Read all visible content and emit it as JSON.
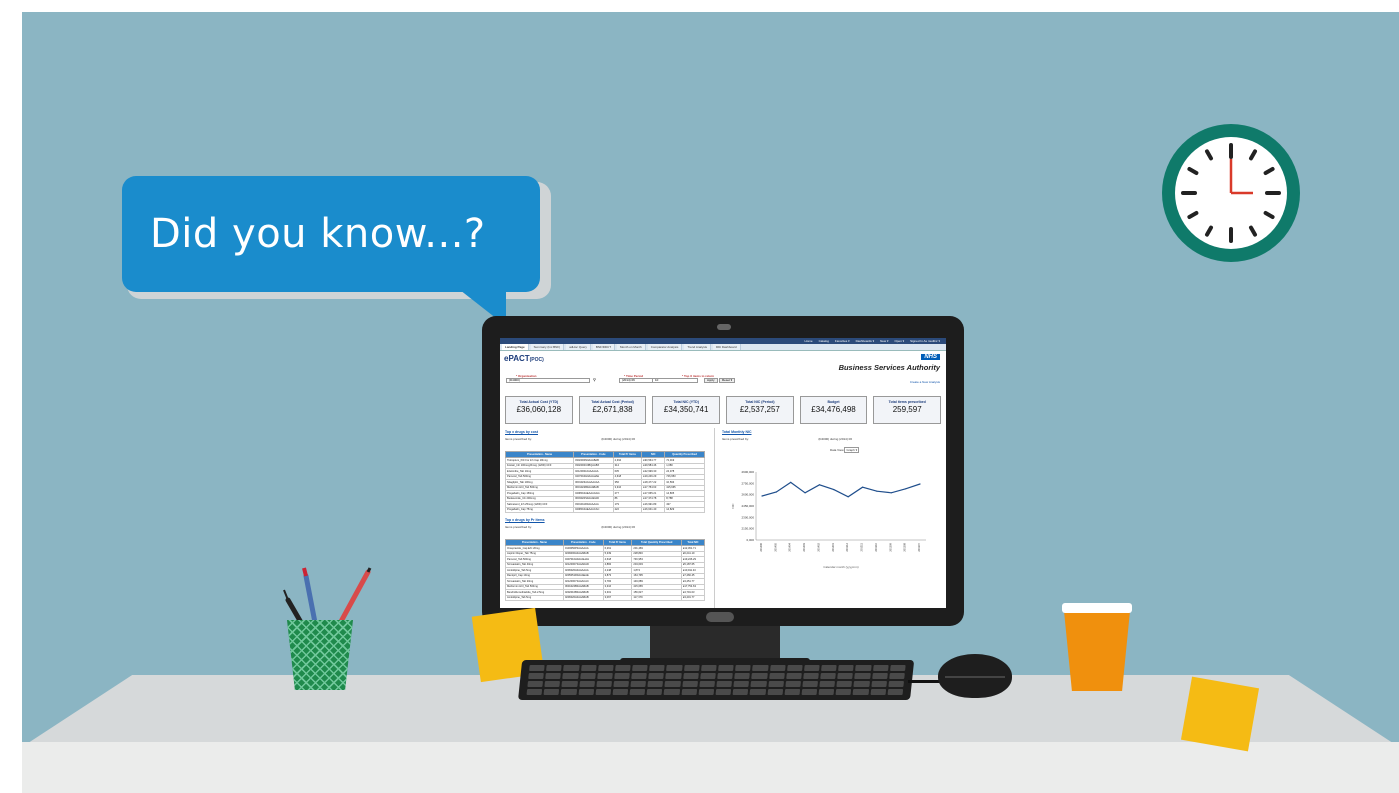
{
  "bubble": {
    "text": "Did you know...?"
  },
  "clock": {
    "time": "3:00"
  },
  "colors": {
    "wall": "#8bb5c3",
    "bubble": "#1a8ccc",
    "clock_ring": "#0f7a6a",
    "clock_hand": "#d93a2a",
    "cup": "#f0900d",
    "sticky": "#f5bb14",
    "pot": "#1f8a4c",
    "nhs_blue": "#005eb8"
  },
  "screen": {
    "topbar": [
      "Home",
      "Catalog",
      "Favorites ▾",
      "Dashboards ▾",
      "New ▾",
      "Open ▾",
      "Signed In As mudlinr ▾"
    ],
    "tabs": [
      "Landing Page",
      "Summary (Inc BNF)",
      "adHoc Query",
      "BNF/DDCT",
      "Month on Month",
      "Comparator Analysis",
      "Trend Analysis",
      "DDi Dashboard"
    ],
    "app_title": "ePACT",
    "app_title_suffix": "(POC)",
    "nhs_logo": "NHS",
    "bsa_name": "Business Services Authority",
    "create_link": "Create a New Analysis",
    "filters": {
      "org_label": "* Organisation",
      "org_value": "(D4000)",
      "period_label": "* Time Period",
      "period_value": "(2014) 06",
      "topx_label": "* Top X items to return",
      "topx_value": "10",
      "apply": "Apply",
      "reset": "Reset ▾"
    },
    "tiles": [
      {
        "title": "Total Actual Cost (YTD)",
        "value": "£36,060,128"
      },
      {
        "title": "Total Actual Cost (Period)",
        "value": "£2,671,838"
      },
      {
        "title": "Total NIC (YTD)",
        "value": "£34,350,741"
      },
      {
        "title": "Total NIC (Period)",
        "value": "£2,537,257"
      },
      {
        "title": "Budget",
        "value": "£34,476,498"
      },
      {
        "title": "Total items prescribed",
        "value": "259,597"
      }
    ],
    "left": {
      "section1": "Top x drugs by cost",
      "sub1_label": "Items prescribed by:",
      "sub1_value": "(D4000) during (2014) 06",
      "table1_headers": [
        "Presentation - Name",
        "Presentation - Code",
        "Total Pr Items",
        "NIC",
        "Quantity Prescribed"
      ],
      "table1_rows": [
        [
          "Tiotropium_Pdr For Inh Cap 18mcg",
          "0302000N0AAABAB",
          "2,394",
          "£90,564.77",
          "72,019"
        ],
        [
          "Fostair_Inh 100mcg/6mcg (120D) CFF",
          "0302000C0BQAABX",
          "314",
          "£29,584.46",
          "1,080"
        ],
        [
          "Ezetimibe_Tab 10mg",
          "0212000L0AAAAAA",
          "635",
          "£22,999.30",
          "24,378"
        ],
        [
          "Pamorel_Tab 500mg",
          "0407010H0AAAHAH",
          "4,618",
          "£19,246.29",
          "746,953"
        ],
        [
          "Sitagliptin_Tab 100mg",
          "0601023AGAAAAAA",
          "356",
          "£18,477.22",
          "10,593"
        ],
        [
          "Metformin HCl_Tab 500mg",
          "0601022B0AAABAB",
          "3,316",
          "£17,754.63",
          "415,665"
        ],
        [
          "Pregabalin_Cap 150mg",
          "0408010AEAAAGAG",
          "277",
          "£17,665.21",
          "14,805"
        ],
        [
          "Budesonide_Inh 200mcg",
          "0603020S0AAADAD",
          "86",
          "£17,374.78",
          "8,788"
        ],
        [
          "Salmeterol_Inh 25mcg (120D) CFF",
          "0301011R0AAAAAA",
          "179",
          "£16,991.89",
          "437"
        ],
        [
          "Pregabalin_Cap 75mg",
          "0408010AEAAACAC",
          "222",
          "£16,641.40",
          "14,829"
        ]
      ],
      "section2": "Top x drugs by Pr items",
      "sub2_label": "Items prescribed by:",
      "sub2_value": "(D4000) during (2014) 06",
      "table2_headers": [
        "Presentation - Name",
        "Presentation - Code",
        "Total Pr Items",
        "Total Quantity Prescribed",
        "Total NIC"
      ],
      "table2_rows": [
        [
          "Omeprazole_Cap E/C 20mg",
          "0103050P0AAAAAA",
          "6,261",
          "201,469",
          "£12,451.71"
        ],
        [
          "Aspirin Disper_Tab 75mg",
          "0209000A0AAABAB",
          "5,339",
          "228,846",
          "£6,241.19"
        ],
        [
          "Pamorel_Tab 500mg",
          "0407010H0AAAHAH",
          "4,618",
          "746,953",
          "£19,246.29"
        ],
        [
          "Simvastatin_Tab 40mg",
          "0212000Y0AAADAD",
          "4,884",
          "204,603",
          "£5,187.65"
        ],
        [
          "Amlodipine_Tab 5mg",
          "0206020A0AAAAAA",
          "4,248",
          "1,874",
          "£10,911.43"
        ],
        [
          "Ramipril_Cap 10mg",
          "0205051R0AAAEAE",
          "3,873",
          "164,795",
          "£7,466.45"
        ],
        [
          "Simvastatin_Tab 20mg",
          "0212000Y0AAACAC",
          "3,784",
          "149,689",
          "£3,451.77"
        ],
        [
          "Metformin HCl_Tab 500mg",
          "0601022B0AAABAB",
          "3,316",
          "415,665",
          "£17,754.63"
        ],
        [
          "Bendroflumethiazide_Tab 2.5mg",
          "0202010B0AAABAB",
          "3,301",
          "156,627",
          "£4,791.03"
        ],
        [
          "Amlodipine_Tab 5mg",
          "0206020A0AAABAB",
          "3,067",
          "117,379",
          "£3,401.77"
        ]
      ]
    },
    "right": {
      "section": "Total Monthly NIC",
      "sub_label": "Items prescribed by:",
      "sub_value": "(D4000) during (2014) 06",
      "data_view_label": "Data View",
      "data_view_value": "Graph ▾"
    }
  },
  "chart_data": {
    "type": "line",
    "title": "",
    "xlabel": "Calendar month (yyyymm)",
    "ylabel": "NIC",
    "x": [
      "201406",
      "201405",
      "201404",
      "201403",
      "201402",
      "201401",
      "201312",
      "201311",
      "201310",
      "201309",
      "201308",
      "201307"
    ],
    "series": [
      {
        "values": [
          2650000,
          2700000,
          2820000,
          2690000,
          2790000,
          2730000,
          2640000,
          2760000,
          2710000,
          2690000,
          2740000,
          2800000
        ]
      }
    ],
    "yticks": [
      "2900,000",
      "2750,000",
      "2600,000",
      "2450,000",
      "2300,000",
      "2150,000",
      "0,000"
    ],
    "ylim": [
      2100000,
      2950000
    ],
    "grid": false
  }
}
